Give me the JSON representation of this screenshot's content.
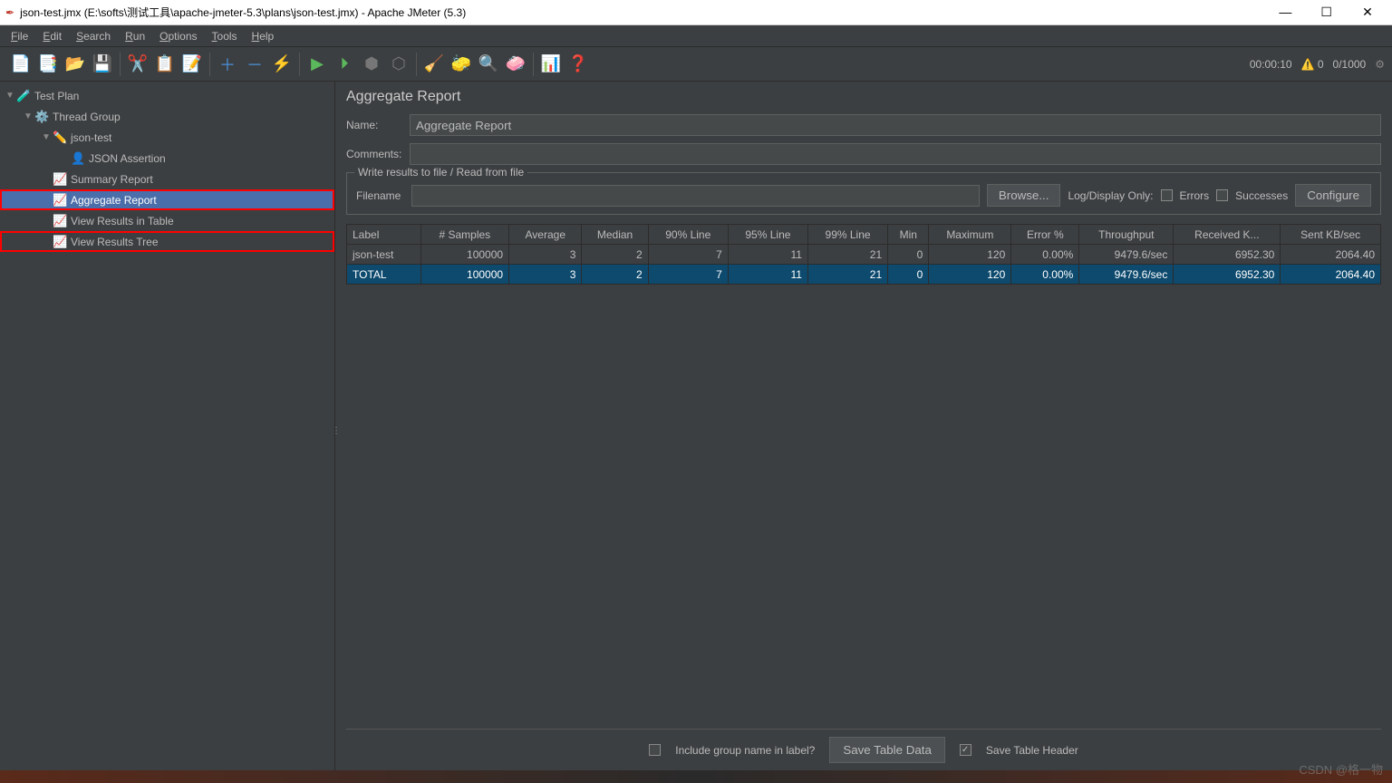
{
  "window": {
    "title": "json-test.jmx (E:\\softs\\测试工具\\apache-jmeter-5.3\\plans\\json-test.jmx) - Apache JMeter (5.3)"
  },
  "menu": [
    "File",
    "Edit",
    "Search",
    "Run",
    "Options",
    "Tools",
    "Help"
  ],
  "status": {
    "time": "00:00:10",
    "warn": "0",
    "threads": "0/1000"
  },
  "tree": {
    "testplan": "Test Plan",
    "threadgroup": "Thread Group",
    "sampler": "json-test",
    "assertion": "JSON Assertion",
    "summary": "Summary Report",
    "aggregate": "Aggregate Report",
    "viewtable": "View Results in Table",
    "viewtree": "View Results Tree"
  },
  "panel": {
    "title": "Aggregate Report",
    "name_label": "Name:",
    "name_value": "Aggregate Report",
    "comments_label": "Comments:",
    "comments_value": "",
    "fieldset_legend": "Write results to file / Read from file",
    "filename_label": "Filename",
    "filename_value": "",
    "browse": "Browse...",
    "logonly": "Log/Display Only:",
    "errors": "Errors",
    "successes": "Successes",
    "configure": "Configure"
  },
  "table": {
    "headers": [
      "Label",
      "# Samples",
      "Average",
      "Median",
      "90% Line",
      "95% Line",
      "99% Line",
      "Min",
      "Maximum",
      "Error %",
      "Throughput",
      "Received K...",
      "Sent KB/sec"
    ],
    "rows": [
      [
        "json-test",
        "100000",
        "3",
        "2",
        "7",
        "11",
        "21",
        "0",
        "120",
        "0.00%",
        "9479.6/sec",
        "6952.30",
        "2064.40"
      ],
      [
        "TOTAL",
        "100000",
        "3",
        "2",
        "7",
        "11",
        "21",
        "0",
        "120",
        "0.00%",
        "9479.6/sec",
        "6952.30",
        "2064.40"
      ]
    ]
  },
  "footer": {
    "include_label": "Include group name in label?",
    "save_data": "Save Table Data",
    "save_header": "Save Table Header"
  },
  "watermark": "CSDN @格一物"
}
